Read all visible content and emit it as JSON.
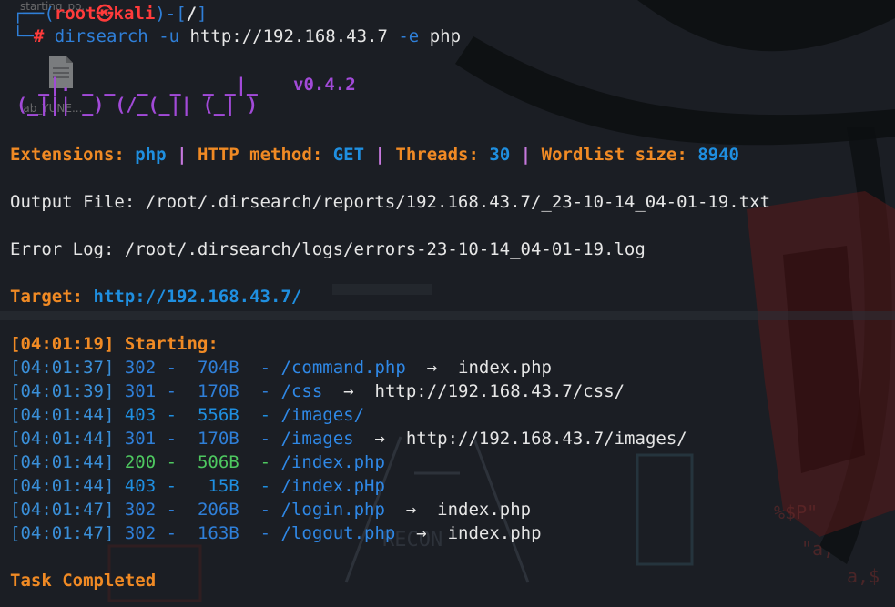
{
  "desktop": {
    "icon1_label": "starting_po...",
    "icon2_label": "lab_YUNE..."
  },
  "prompt": {
    "open": "┌──(",
    "user": "root",
    "at_symbol": "㉿",
    "host": "kali",
    "close": ")-[",
    "dir": "/",
    "end": "]",
    "corner": "└─",
    "hash": "#",
    "command": "dirsearch",
    "flag_u": "-u",
    "url": "http://192.168.43.7",
    "flag_e": "-e",
    "ext": "php"
  },
  "banner": {
    "art_line1": "  _|. _ _  _  _  _ _|_",
    "art_line2": "(_||| _) (/_(_|| (_| )",
    "version": "v0.4.2"
  },
  "config": {
    "ext_label": "Extensions:",
    "ext_value": "php",
    "sep": "|",
    "method_label": "HTTP method:",
    "method_value": "GET",
    "threads_label": "Threads:",
    "threads_value": "30",
    "wordlist_label": "Wordlist size:",
    "wordlist_value": "8940"
  },
  "output_file": "Output File: /root/.dirsearch/reports/192.168.43.7/_23-10-14_04-01-19.txt",
  "error_log": "Error Log: /root/.dirsearch/logs/errors-23-10-14_04-01-19.log",
  "target": {
    "label": "Target:",
    "url": "http://192.168.43.7/"
  },
  "starting": "[04:01:19] Starting:",
  "results": [
    {
      "time": "[04:01:37]",
      "status": "302",
      "size": " 704B",
      "path": "/command.php",
      "redirect": "index.php"
    },
    {
      "time": "[04:01:39]",
      "status": "301",
      "size": " 170B",
      "path": "/css",
      "redirect": "http://192.168.43.7/css/"
    },
    {
      "time": "[04:01:44]",
      "status": "403",
      "size": " 556B",
      "path": "/images/",
      "redirect": ""
    },
    {
      "time": "[04:01:44]",
      "status": "301",
      "size": " 170B",
      "path": "/images",
      "redirect": "http://192.168.43.7/images/"
    },
    {
      "time": "[04:01:44]",
      "status": "200",
      "size": " 506B",
      "path": "/index.php",
      "redirect": ""
    },
    {
      "time": "[04:01:44]",
      "status": "403",
      "size": "  15B",
      "path": "/index.pHp",
      "redirect": ""
    },
    {
      "time": "[04:01:47]",
      "status": "302",
      "size": " 206B",
      "path": "/login.php",
      "redirect": "index.php"
    },
    {
      "time": "[04:01:47]",
      "status": "302",
      "size": " 163B",
      "path": "/logout.php",
      "redirect": "index.php"
    }
  ],
  "result_dash": "-",
  "result_arrow": "→",
  "task_completed": "Task Completed",
  "colors": {
    "background": "#1b1e24",
    "orange": "#f08a24",
    "blue": "#1f8fe0",
    "purple": "#a24ad8",
    "red": "#ff3b3b"
  }
}
